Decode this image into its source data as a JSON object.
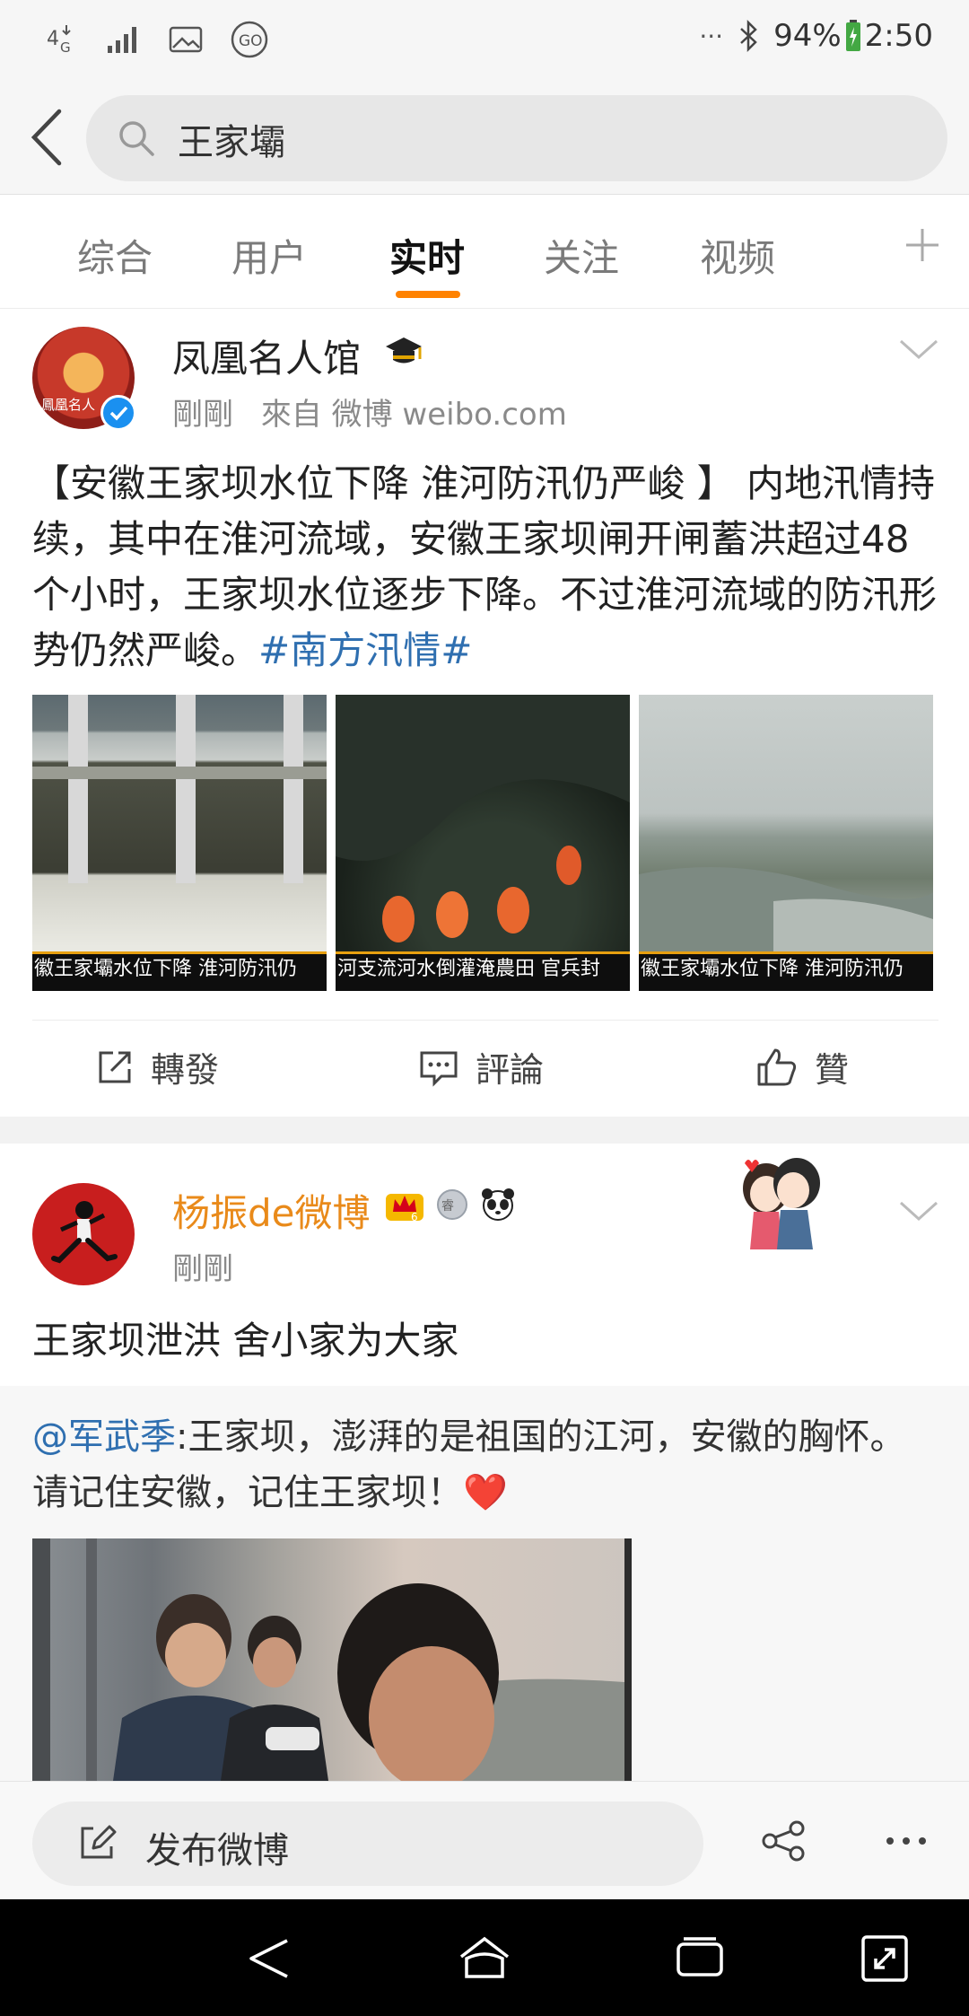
{
  "status_bar": {
    "network": "4G",
    "battery": "94%",
    "time": "2:50",
    "dots": "···"
  },
  "search": {
    "query": "王家壩"
  },
  "tabs": [
    {
      "label": "综合"
    },
    {
      "label": "用户"
    },
    {
      "label": "实时"
    },
    {
      "label": "关注"
    },
    {
      "label": "视频"
    }
  ],
  "active_tab": "实时",
  "colors": {
    "accent": "#ff8200",
    "link": "#2f6fb0",
    "vip_name": "#e98a1a"
  },
  "post1": {
    "author": "凤凰名人馆",
    "avatar_text": "鳳凰名人",
    "time": "剛剛",
    "source": "來自 微博 weibo.com",
    "text": "【安徽王家坝水位下降 淮河防汛仍严峻 】 内地汛情持续，其中在淮河流域，安徽王家坝闸开闸蓄洪超过48个小时，王家坝水位逐步下降。不过淮河流域的防汛形势仍然严峻。",
    "hashtag": "#南方汛情#",
    "images": [
      {
        "caption": "徽王家壩水位下降 淮河防汛仍"
      },
      {
        "caption": "河支流河水倒灌淹農田 官兵封"
      },
      {
        "caption": "徽王家壩水位下降 淮河防汛仍"
      }
    ],
    "actions": {
      "repost": "轉發",
      "comment": "評論",
      "like": "贊"
    }
  },
  "post2": {
    "author": "杨振de微博",
    "time": "剛剛",
    "text": "王家坝泄洪 舍小家为大家",
    "repost": {
      "mention": "@军武季",
      "text": ":王家坝，澎湃的是祖国的江河，安徽的胸怀。 请记住安徽，记住王家坝！",
      "emoji": "❤️"
    }
  },
  "compose": {
    "placeholder": "发布微博"
  },
  "icons": [
    "back-icon",
    "search-icon",
    "plus-icon",
    "chevron-down-icon",
    "verified-icon",
    "share-icon",
    "comment-icon",
    "like-icon",
    "edit-icon",
    "more-icon"
  ]
}
